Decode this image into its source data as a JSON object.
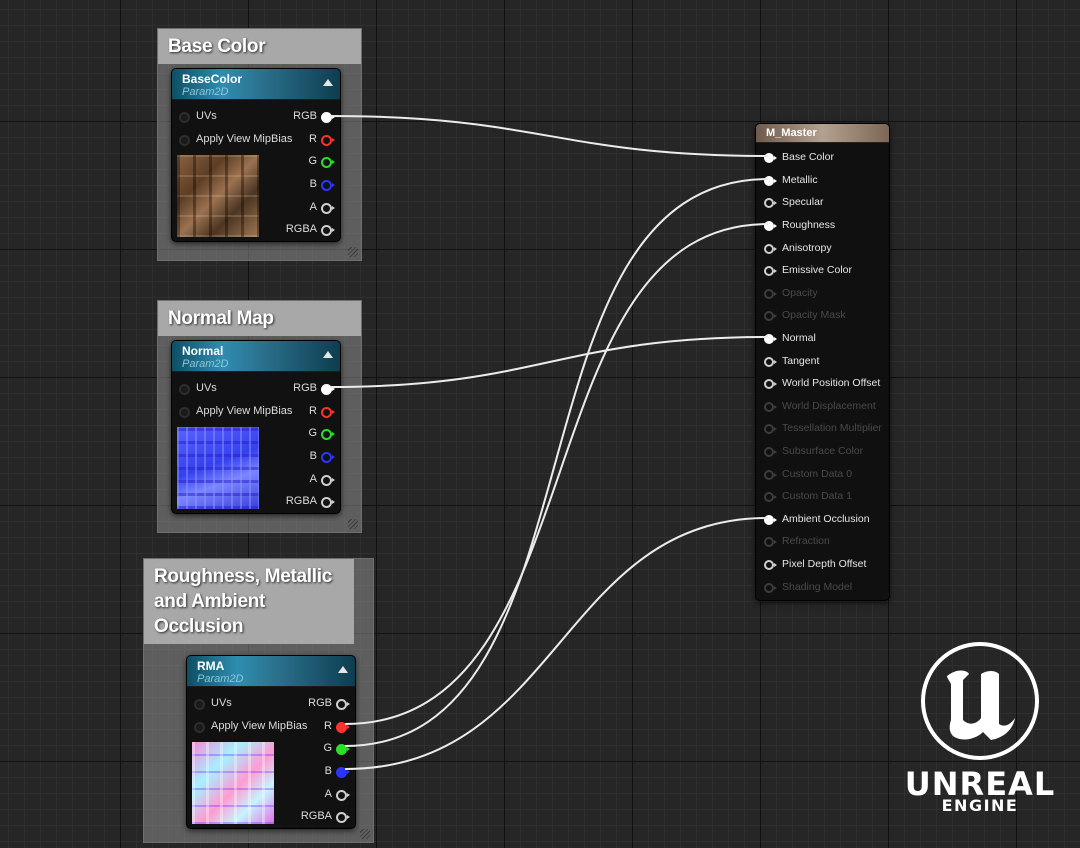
{
  "comments": [
    {
      "title": "Base Color"
    },
    {
      "title": "Normal Map"
    },
    {
      "title": "Roughness, Metallic and Ambient Occlusion"
    }
  ],
  "texture_nodes": [
    {
      "title": "BaseColor",
      "subtitle": "Param2D",
      "inputs": [
        "UVs",
        "Apply View MipBias"
      ],
      "outputs": [
        "RGB",
        "R",
        "G",
        "B",
        "A",
        "RGBA"
      ]
    },
    {
      "title": "Normal",
      "subtitle": "Param2D",
      "inputs": [
        "UVs",
        "Apply View MipBias"
      ],
      "outputs": [
        "RGB",
        "R",
        "G",
        "B",
        "A",
        "RGBA"
      ]
    },
    {
      "title": "RMA",
      "subtitle": "Param2D",
      "inputs": [
        "UVs",
        "Apply View MipBias"
      ],
      "outputs": [
        "RGB",
        "R",
        "G",
        "B",
        "A",
        "RGBA"
      ]
    }
  ],
  "material_node": {
    "title": "M_Master",
    "pins": [
      {
        "label": "Base Color",
        "state": "connected"
      },
      {
        "label": "Metallic",
        "state": "connected"
      },
      {
        "label": "Specular",
        "state": "available"
      },
      {
        "label": "Roughness",
        "state": "connected"
      },
      {
        "label": "Anisotropy",
        "state": "available"
      },
      {
        "label": "Emissive Color",
        "state": "available"
      },
      {
        "label": "Opacity",
        "state": "disabled"
      },
      {
        "label": "Opacity Mask",
        "state": "disabled"
      },
      {
        "label": "Normal",
        "state": "connected"
      },
      {
        "label": "Tangent",
        "state": "available"
      },
      {
        "label": "World Position Offset",
        "state": "available"
      },
      {
        "label": "World Displacement",
        "state": "disabled"
      },
      {
        "label": "Tessellation Multiplier",
        "state": "disabled"
      },
      {
        "label": "Subsurface Color",
        "state": "disabled"
      },
      {
        "label": "Custom Data 0",
        "state": "disabled"
      },
      {
        "label": "Custom Data 1",
        "state": "disabled"
      },
      {
        "label": "Ambient Occlusion",
        "state": "connected"
      },
      {
        "label": "Refraction",
        "state": "disabled"
      },
      {
        "label": "Pixel Depth Offset",
        "state": "available"
      },
      {
        "label": "Shading Model",
        "state": "disabled"
      }
    ]
  },
  "connections": [
    {
      "from": "BaseColor.RGB",
      "to": "Base Color"
    },
    {
      "from": "Normal.RGB",
      "to": "Normal"
    },
    {
      "from": "RMA.R",
      "to": "Roughness"
    },
    {
      "from": "RMA.G",
      "to": "Metallic"
    },
    {
      "from": "RMA.B",
      "to": "Ambient Occlusion"
    }
  ],
  "pin_colors": {
    "R": "#ff3030",
    "G": "#28e028",
    "B": "#2a35ff",
    "white": "#ffffff",
    "wire": "#ececec"
  },
  "logo": {
    "icon": "unreal-engine-u-icon",
    "line1": "UNREAL",
    "line2": "ENGINE"
  }
}
